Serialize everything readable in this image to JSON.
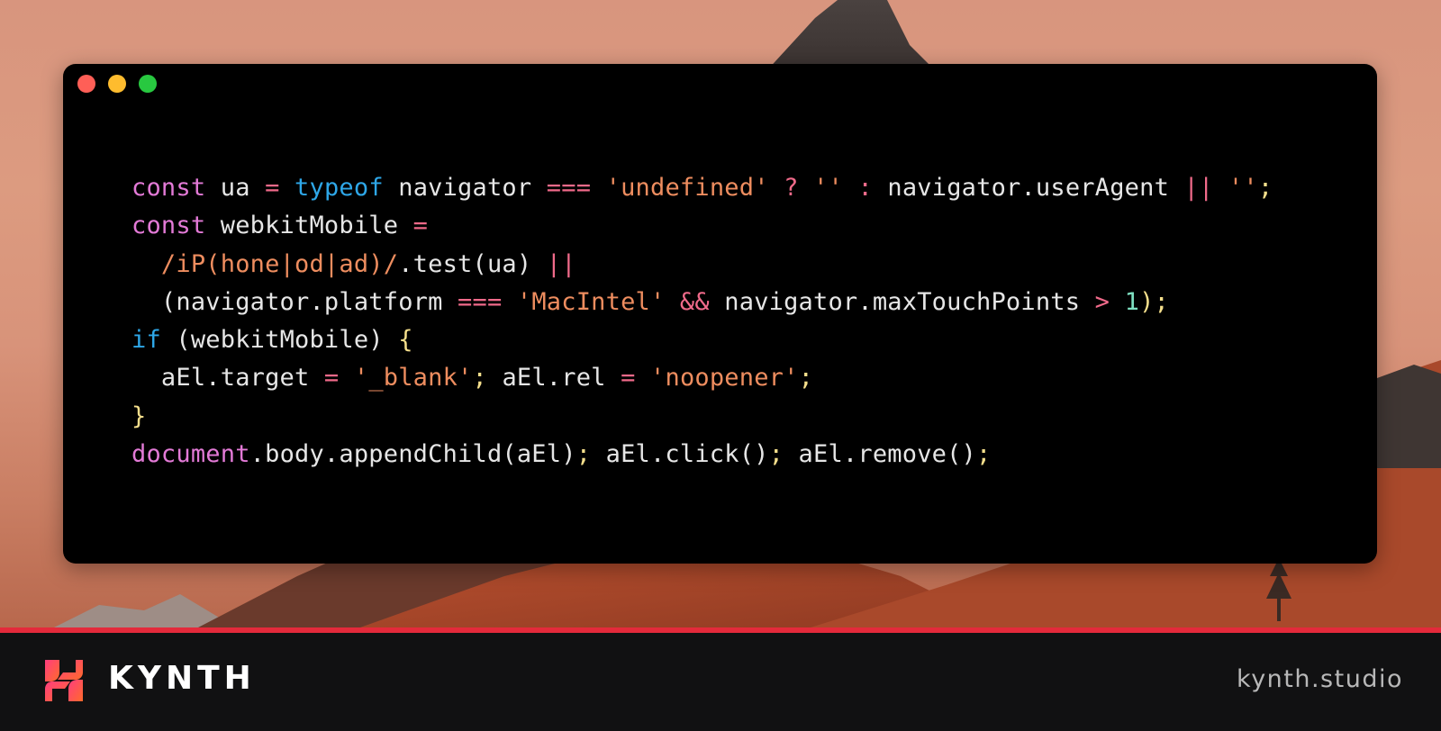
{
  "window": {
    "buttons": {
      "close": "close",
      "minimize": "minimize",
      "maximize": "maximize"
    }
  },
  "code": {
    "lines": [
      [
        {
          "t": "const",
          "c": "kw"
        },
        {
          "t": " ua ",
          "c": "id"
        },
        {
          "t": "=",
          "c": "op"
        },
        {
          "t": " ",
          "c": "id"
        },
        {
          "t": "typeof",
          "c": "kw2"
        },
        {
          "t": " navigator ",
          "c": "id"
        },
        {
          "t": "===",
          "c": "op"
        },
        {
          "t": " ",
          "c": "id"
        },
        {
          "t": "'undefined'",
          "c": "str"
        },
        {
          "t": " ",
          "c": "id"
        },
        {
          "t": "?",
          "c": "op"
        },
        {
          "t": " ",
          "c": "id"
        },
        {
          "t": "''",
          "c": "str"
        },
        {
          "t": " ",
          "c": "id"
        },
        {
          "t": ":",
          "c": "op"
        },
        {
          "t": " navigator.userAgent ",
          "c": "id"
        },
        {
          "t": "||",
          "c": "op"
        },
        {
          "t": " ",
          "c": "id"
        },
        {
          "t": "''",
          "c": "str"
        },
        {
          "t": ";",
          "c": "pun"
        }
      ],
      [
        {
          "t": "const",
          "c": "kw"
        },
        {
          "t": " webkitMobile ",
          "c": "id"
        },
        {
          "t": "=",
          "c": "op"
        }
      ],
      [
        {
          "t": "  ",
          "c": "id"
        },
        {
          "t": "/iP(hone|od|ad)/",
          "c": "rx"
        },
        {
          "t": ".test(ua) ",
          "c": "id"
        },
        {
          "t": "||",
          "c": "op"
        }
      ],
      [
        {
          "t": "  (navigator.platform ",
          "c": "id"
        },
        {
          "t": "===",
          "c": "op"
        },
        {
          "t": " ",
          "c": "id"
        },
        {
          "t": "'MacIntel'",
          "c": "str"
        },
        {
          "t": " ",
          "c": "id"
        },
        {
          "t": "&&",
          "c": "op"
        },
        {
          "t": " navigator.maxTouchPoints ",
          "c": "id"
        },
        {
          "t": ">",
          "c": "op"
        },
        {
          "t": " ",
          "c": "id"
        },
        {
          "t": "1",
          "c": "num"
        },
        {
          "t": ");",
          "c": "pun"
        }
      ],
      [
        {
          "t": "if",
          "c": "kw2"
        },
        {
          "t": " (webkitMobile) ",
          "c": "id"
        },
        {
          "t": "{",
          "c": "pun"
        }
      ],
      [
        {
          "t": "  aEl.target ",
          "c": "id"
        },
        {
          "t": "=",
          "c": "op"
        },
        {
          "t": " ",
          "c": "id"
        },
        {
          "t": "'_blank'",
          "c": "str"
        },
        {
          "t": ";",
          "c": "pun"
        },
        {
          "t": " aEl.rel ",
          "c": "id"
        },
        {
          "t": "=",
          "c": "op"
        },
        {
          "t": " ",
          "c": "id"
        },
        {
          "t": "'noopener'",
          "c": "str"
        },
        {
          "t": ";",
          "c": "pun"
        }
      ],
      [
        {
          "t": "}",
          "c": "pun"
        }
      ],
      [
        {
          "t": "document",
          "c": "kw"
        },
        {
          "t": ".body.appendChild(aEl)",
          "c": "id"
        },
        {
          "t": ";",
          "c": "pun"
        },
        {
          "t": " aEl.click()",
          "c": "id"
        },
        {
          "t": ";",
          "c": "pun"
        },
        {
          "t": " aEl.remove()",
          "c": "id"
        },
        {
          "t": ";",
          "c": "pun"
        }
      ]
    ]
  },
  "footer": {
    "brand": "KYNTH",
    "site": "kynth.studio"
  },
  "colors": {
    "accent": "#e42a3b",
    "keyword": "#e37ad7",
    "keyword_blue": "#2ea7e8",
    "operator": "#f06a8a",
    "string": "#ee8d5f",
    "number": "#7ee0c2"
  }
}
